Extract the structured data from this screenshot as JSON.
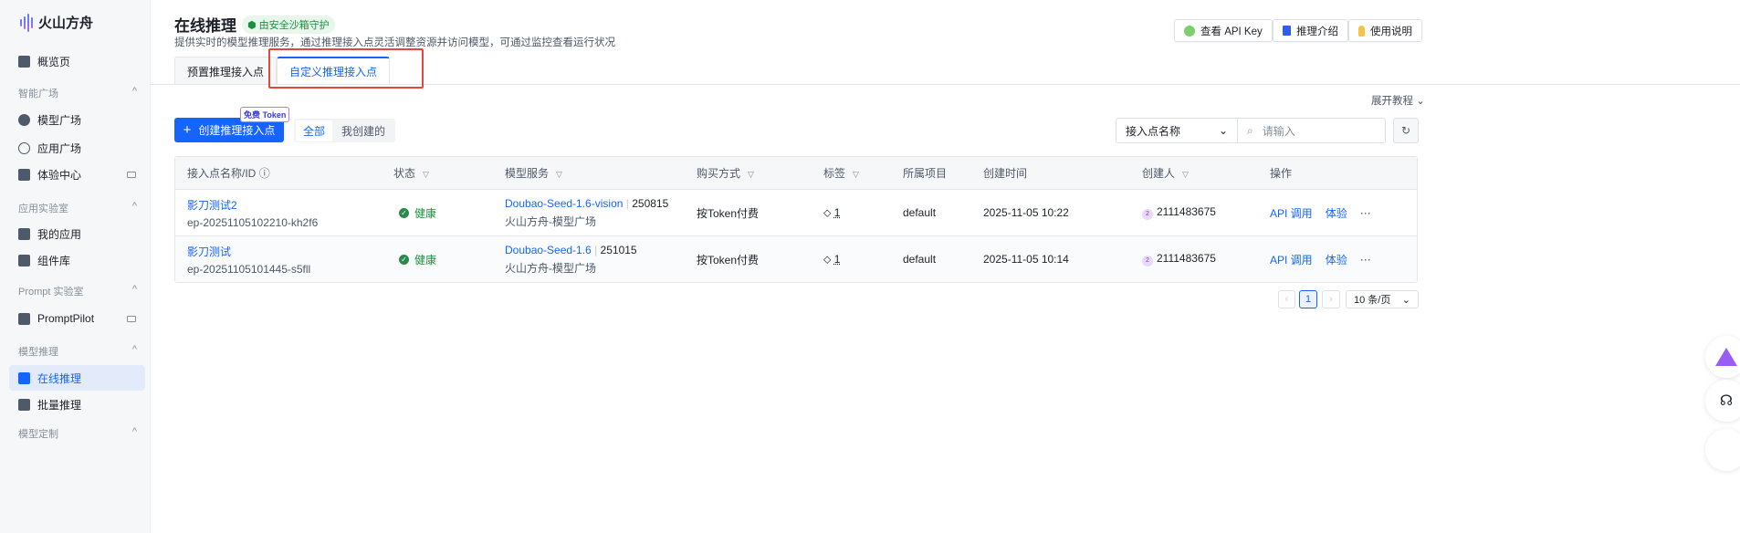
{
  "sidebar": {
    "brand": "火山方舟",
    "overview": "概览页",
    "groups": [
      {
        "label": "智能广场",
        "items": [
          "模型广场",
          "应用广场",
          "体验中心"
        ]
      },
      {
        "label": "应用实验室",
        "items": [
          "我的应用",
          "组件库"
        ]
      },
      {
        "label": "Prompt 实验室",
        "items": [
          "PromptPilot"
        ]
      },
      {
        "label": "模型推理",
        "items": [
          "在线推理",
          "批量推理"
        ]
      },
      {
        "label": "模型定制",
        "items": []
      }
    ]
  },
  "header": {
    "title": "在线推理",
    "safe_badge": "由安全沙箱守护",
    "subtitle": "提供实时的模型推理服务，通过推理接入点灵活调整资源并访问模型，可通过监控查看运行状况",
    "buttons": [
      "查看 API Key",
      "推理介绍",
      "使用说明"
    ]
  },
  "tabs": [
    "预置推理接入点",
    "自定义推理接入点"
  ],
  "toolbar": {
    "expand": "展开教程",
    "create": "创建推理接入点",
    "free_tag": "免费 Token",
    "segments": [
      "全部",
      "我创建的"
    ],
    "filter_field": "接入点名称",
    "search_placeholder": "请输入"
  },
  "table": {
    "headers": [
      "接入点名称/ID",
      "状态",
      "模型服务",
      "购买方式",
      "标签",
      "所属项目",
      "创建时间",
      "创建人",
      "操作"
    ],
    "rows": [
      {
        "name": "影刀测试2",
        "id": "ep-20251105102210-kh2f6",
        "status": "健康",
        "model": "Doubao-Seed-1.6-vision",
        "version": "250815",
        "source": "火山方舟-模型广场",
        "purchase": "按Token付费",
        "tags": "1",
        "project": "default",
        "created": "2025-11-05 10:22",
        "avatar": "2",
        "creator": "2111483675",
        "actions": [
          "API 调用",
          "体验",
          "···"
        ]
      },
      {
        "name": "影刀测试",
        "id": "ep-20251105101445-s5fll",
        "status": "健康",
        "model": "Doubao-Seed-1.6",
        "version": "251015",
        "source": "火山方舟-模型广场",
        "purchase": "按Token付费",
        "tags": "1",
        "project": "default",
        "created": "2025-11-05 10:14",
        "avatar": "2",
        "creator": "2111483675",
        "actions": [
          "API 调用",
          "体验",
          "···"
        ]
      }
    ]
  },
  "pagination": {
    "page": "1",
    "page_size": "10 条/页"
  }
}
